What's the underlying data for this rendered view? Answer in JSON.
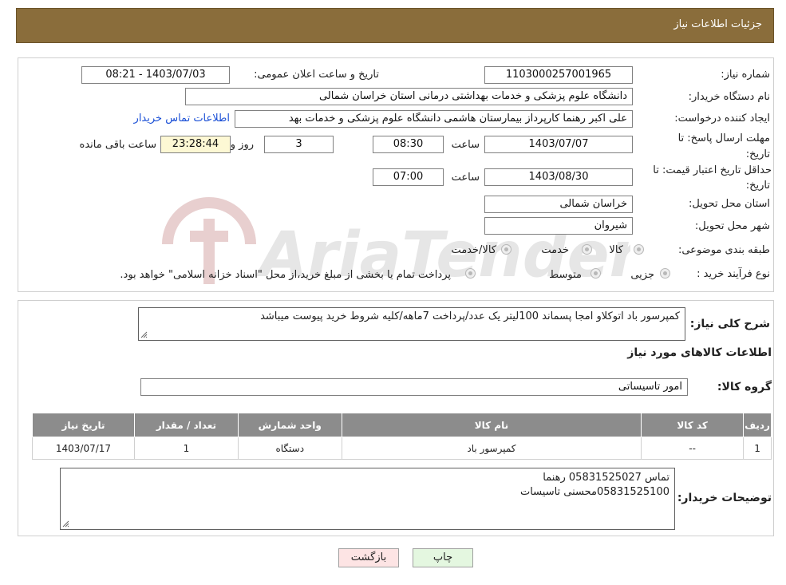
{
  "header": {
    "title": "جزئیات اطلاعات نیاز"
  },
  "form": {
    "need_number_label": "شماره نیاز:",
    "need_number": "1103000257001965",
    "announce_label": "تاریخ و ساعت اعلان عمومی:",
    "announce_value": "1403/07/03 - 08:21",
    "buyer_org_label": "نام دستگاه خریدار:",
    "buyer_org": "دانشگاه علوم پزشکی و خدمات بهداشتی درمانی استان خراسان شمالی",
    "requester_label": "ایجاد کننده درخواست:",
    "requester": "علی اکبر رهنما کارپرداز بیمارستان هاشمی دانشگاه علوم پزشکی و خدمات بهد",
    "contact_link": "اطلاعات تماس خریدار",
    "reply_deadline_label_1": "مهلت ارسال پاسخ: تا",
    "reply_deadline_label_2": "تاریخ:",
    "reply_date": "1403/07/07",
    "time_label": "ساعت",
    "reply_time": "08:30",
    "days_value": "3",
    "day_and_label": "روز و",
    "remaining_time": "23:28:44",
    "remaining_label": "ساعت باقی مانده",
    "price_validity_label_1": "حداقل تاریخ اعتبار قیمت: تا",
    "price_validity_label_2": "تاریخ:",
    "validity_date": "1403/08/30",
    "validity_time": "07:00",
    "province_label": "استان محل تحویل:",
    "province": "خراسان شمالی",
    "city_label": "شهر محل تحویل:",
    "city": "شیروان",
    "category_label": "طبقه بندی موضوعی:",
    "category_options": [
      "کالا",
      "خدمت",
      "کالا/خدمت"
    ],
    "purchase_type_label": "نوع فرآیند خرید :",
    "purchase_type_options": [
      "جزیی",
      "متوسط"
    ],
    "purchase_note": "پرداخت تمام یا بخشی از مبلغ خرید،از محل \"اسناد خزانه اسلامی\" خواهد بود."
  },
  "details": {
    "summary_label": "شرح کلی نیاز:",
    "summary": "کمپرسور باد اتوکلاو امجا پسماند 100لیتر یک عدد/پرداخت 7ماهه/کلیه شروط خرید پیوست میباشد",
    "goods_info_title": "اطلاعات کالاهای مورد نیاز",
    "goods_group_label": "گروه کالا:",
    "goods_group": "امور تاسیساتی",
    "table": {
      "headers": [
        "ردیف",
        "کد کالا",
        "نام کالا",
        "واحد شمارش",
        "تعداد / مقدار",
        "تاریخ نیاز"
      ],
      "rows": [
        [
          "1",
          "--",
          "کمپرسور باد",
          "دستگاه",
          "1",
          "1403/07/17"
        ]
      ]
    },
    "buyer_notes_label": "توضیحات خریدار:",
    "buyer_notes_line1": "تماس 05831525027 رهنما",
    "buyer_notes_line2": "05831525100محسنی تاسیسات"
  },
  "buttons": {
    "print": "چاپ",
    "back": "بازگشت"
  },
  "watermark": {
    "text": "AriaTender.neT"
  },
  "colors": {
    "header_bg": "#8a6d3b",
    "table_header_bg": "#8c8c8c",
    "link": "#1a4fd6",
    "back_button_bg": "#fde4e4",
    "print_button_bg": "#e4f7e0"
  }
}
